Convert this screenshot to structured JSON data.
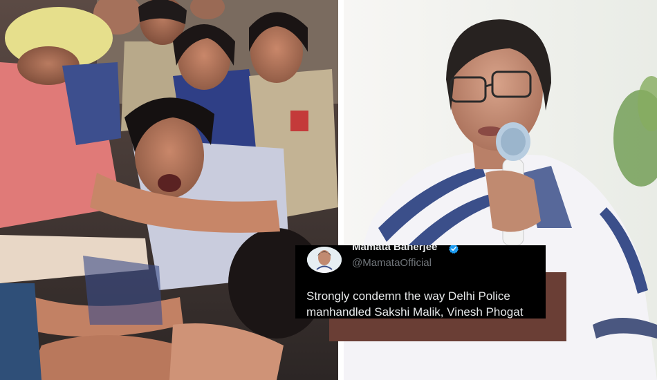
{
  "tweet": {
    "author_name": "Mamata Banerjee",
    "author_handle": "@MamataOfficial",
    "verified": true,
    "text_lines": [
      "Strongly condemn the way Delhi Police",
      "manhandled Sakshi Malik, Vinesh Phogat"
    ]
  },
  "colors": {
    "tweet_background": "#000000",
    "tweet_text": "#e7e9ea",
    "tweet_handle": "#71767b",
    "verified_badge": "#1d9bf0",
    "backing_block": "#6a3e35"
  },
  "images": {
    "left": "protest-scene-photo",
    "right": "speaker-with-microphone-photo"
  }
}
